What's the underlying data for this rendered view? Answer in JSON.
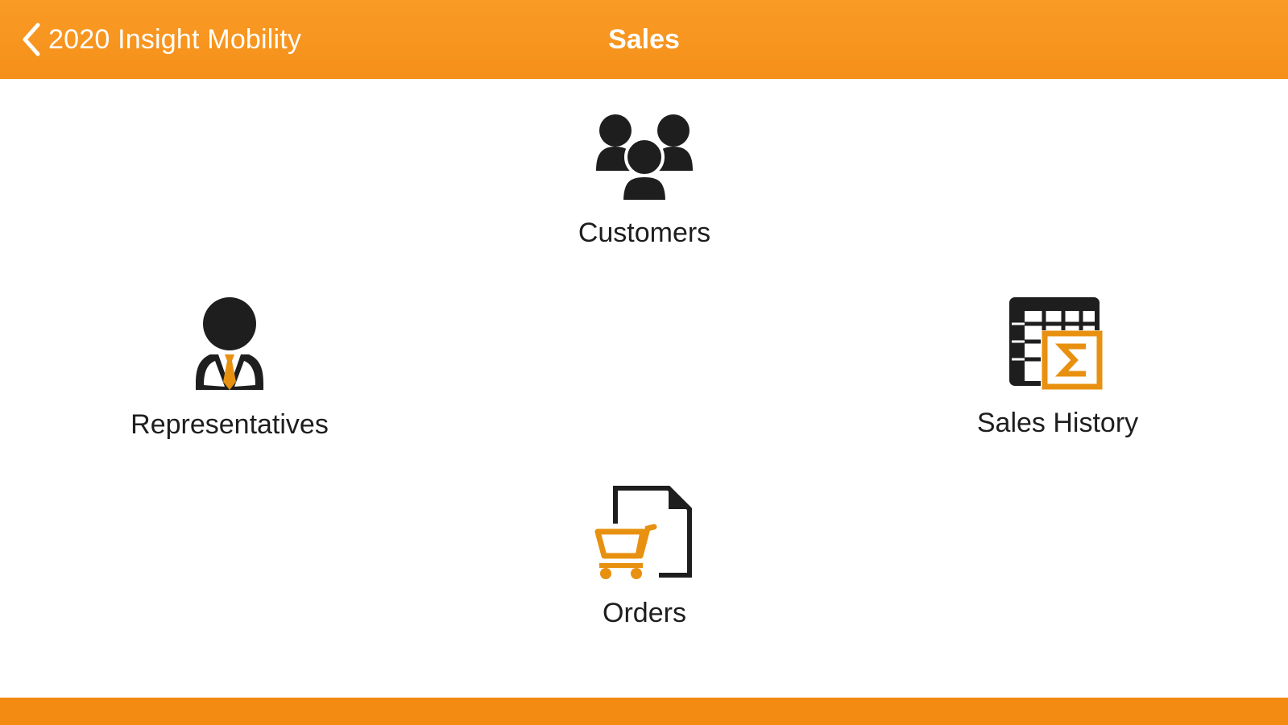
{
  "header": {
    "back_label": "2020 Insight Mobility",
    "title": "Sales"
  },
  "menu": {
    "customers": {
      "label": "Customers",
      "icon": "people-group-icon"
    },
    "representatives": {
      "label": "Representatives",
      "icon": "sales-rep-icon"
    },
    "sales_history": {
      "label": "Sales History",
      "icon": "spreadsheet-sigma-icon"
    },
    "orders": {
      "label": "Orders",
      "icon": "document-cart-icon"
    }
  },
  "colors": {
    "accent": "#f7941d",
    "icon_dark": "#1e1e1e",
    "icon_accent": "#e8900f",
    "background": "#ffffff"
  }
}
